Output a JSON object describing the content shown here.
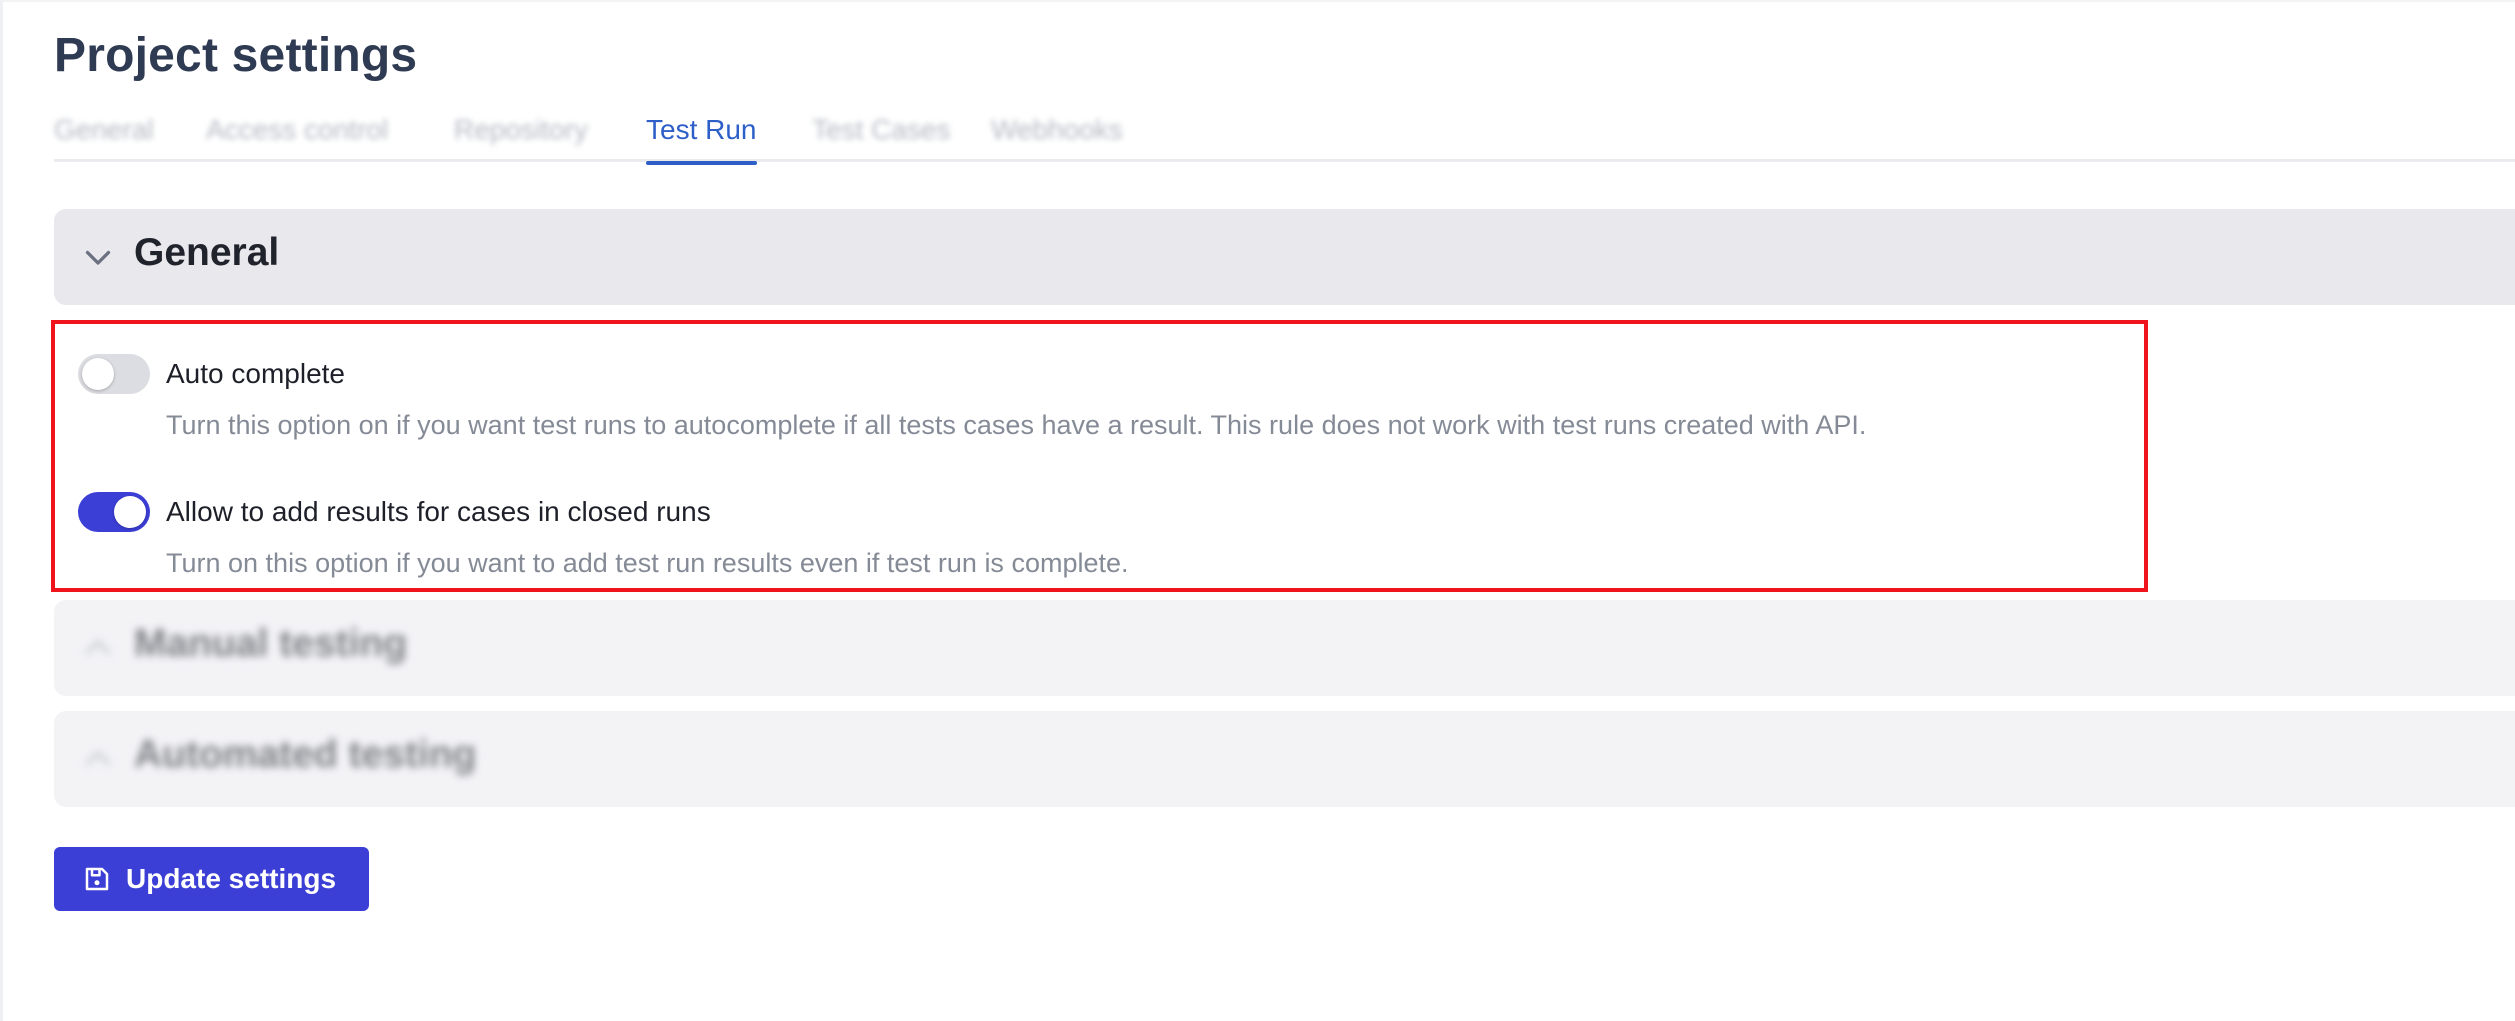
{
  "page": {
    "title": "Project settings"
  },
  "tabs": [
    {
      "label": "General",
      "active": false
    },
    {
      "label": "Access control",
      "active": false
    },
    {
      "label": "Repository",
      "active": false
    },
    {
      "label": "Test Run",
      "active": true
    },
    {
      "label": "Test Cases",
      "active": false
    },
    {
      "label": "Webhooks",
      "active": false
    }
  ],
  "sections": {
    "general": {
      "title": "General",
      "expanded": true
    },
    "manual": {
      "title": "Manual testing",
      "expanded": false
    },
    "automated": {
      "title": "Automated testing",
      "expanded": false
    }
  },
  "settings": [
    {
      "label": "Auto complete",
      "description": "Turn this option on if you want test runs to autocomplete if all tests cases have a result. This rule does not work with test runs created with API.",
      "enabled": false
    },
    {
      "label": "Allow to add results for cases in closed runs",
      "description": "Turn on this option if you want to add test run results even if test run is complete.",
      "enabled": true
    }
  ],
  "actions": {
    "update_label": "Update settings"
  },
  "colors": {
    "accent": "#3c3fd6",
    "active_tab": "#2e5fc9",
    "highlight_border": "#f0141c"
  },
  "icons": {
    "section_expanded": "chevron-down-icon",
    "section_collapsed": "chevron-up-icon",
    "update": "save-icon"
  }
}
